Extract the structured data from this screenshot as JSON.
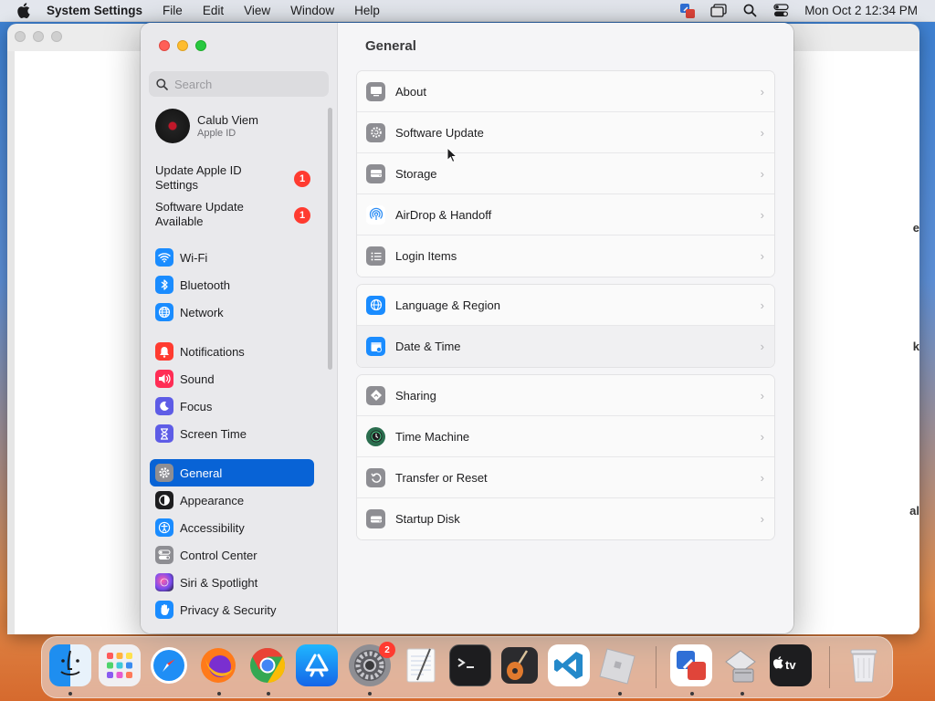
{
  "menubar": {
    "app_name": "System Settings",
    "menus": [
      "File",
      "Edit",
      "View",
      "Window",
      "Help"
    ],
    "clock": "Mon Oct 2  12:34 PM"
  },
  "background_window": {
    "peek_letters": [
      "e",
      "k",
      "al"
    ]
  },
  "sidebar": {
    "search_placeholder": "Search",
    "profile": {
      "name": "Calub Viem",
      "subtitle": "Apple ID"
    },
    "notices": [
      {
        "label": "Update Apple ID Settings",
        "badge": "1"
      },
      {
        "label": "Software Update Available",
        "badge": "1"
      }
    ],
    "groups": [
      [
        {
          "label": "Wi-Fi",
          "icon": "wifi-icon",
          "color": "#1a8cff"
        },
        {
          "label": "Bluetooth",
          "icon": "bluetooth-icon",
          "color": "#1a8cff"
        },
        {
          "label": "Network",
          "icon": "globe-icon",
          "color": "#1a8cff"
        }
      ],
      [
        {
          "label": "Notifications",
          "icon": "bell-icon",
          "color": "#ff3b30"
        },
        {
          "label": "Sound",
          "icon": "speaker-icon",
          "color": "#ff2d55"
        },
        {
          "label": "Focus",
          "icon": "moon-icon",
          "color": "#5e5ce6"
        },
        {
          "label": "Screen Time",
          "icon": "hourglass-icon",
          "color": "#5e5ce6"
        }
      ],
      [
        {
          "label": "General",
          "icon": "gear-icon",
          "color": "#8e8e93",
          "selected": true
        },
        {
          "label": "Appearance",
          "icon": "appearance-icon",
          "color": "#1d1d1f"
        },
        {
          "label": "Accessibility",
          "icon": "accessibility-icon",
          "color": "#1a8cff"
        },
        {
          "label": "Control Center",
          "icon": "toggles-icon",
          "color": "#8e8e93"
        },
        {
          "label": "Siri & Spotlight",
          "icon": "siri-icon",
          "color": "#a34fd6"
        },
        {
          "label": "Privacy & Security",
          "icon": "hand-icon",
          "color": "#1a8cff"
        }
      ]
    ]
  },
  "main": {
    "title": "General",
    "groups": [
      [
        {
          "label": "About",
          "icon": "display-icon",
          "color": "#8e8e93"
        },
        {
          "label": "Software Update",
          "icon": "update-gear-icon",
          "color": "#8e8e93"
        },
        {
          "label": "Storage",
          "icon": "drive-icon",
          "color": "#8e8e93"
        },
        {
          "label": "AirDrop & Handoff",
          "icon": "airdrop-icon",
          "color": "#ffffff"
        },
        {
          "label": "Login Items",
          "icon": "list-icon",
          "color": "#8e8e93"
        }
      ],
      [
        {
          "label": "Language & Region",
          "icon": "globe-icon",
          "color": "#1a8cff"
        },
        {
          "label": "Date & Time",
          "icon": "calendar-clock-icon",
          "color": "#1a8cff",
          "hover": true
        }
      ],
      [
        {
          "label": "Sharing",
          "icon": "sharing-icon",
          "color": "#8e8e93"
        },
        {
          "label": "Time Machine",
          "icon": "time-machine-icon",
          "color": "#2b6e4f"
        },
        {
          "label": "Transfer or Reset",
          "icon": "reset-icon",
          "color": "#8e8e93"
        },
        {
          "label": "Startup Disk",
          "icon": "disk-icon",
          "color": "#8e8e93"
        }
      ]
    ]
  },
  "dock": {
    "items": [
      {
        "name": "finder",
        "icon": "finder-icon",
        "running": true
      },
      {
        "name": "launchpad",
        "icon": "launchpad-icon",
        "running": false
      },
      {
        "name": "safari",
        "icon": "safari-icon",
        "running": false
      },
      {
        "name": "firefox",
        "icon": "firefox-icon",
        "running": true
      },
      {
        "name": "chrome",
        "icon": "chrome-icon",
        "running": true
      },
      {
        "name": "app-store",
        "icon": "app-store-icon",
        "running": false
      },
      {
        "name": "system-settings",
        "icon": "settings-gear-icon",
        "running": true,
        "badge": "2"
      },
      {
        "name": "textedit",
        "icon": "notepad-icon",
        "running": false
      },
      {
        "name": "terminal",
        "icon": "terminal-icon",
        "running": false
      },
      {
        "name": "garageband",
        "icon": "guitar-icon",
        "running": false
      },
      {
        "name": "vscode",
        "icon": "vscode-icon",
        "running": false
      },
      {
        "name": "roblox",
        "icon": "roblox-icon",
        "running": true
      },
      {
        "name": "remote-desktop",
        "icon": "remote-desktop-icon",
        "running": true
      },
      {
        "name": "vmware",
        "icon": "vm-icon",
        "running": true
      },
      {
        "name": "apple-tv",
        "icon": "apple-tv-icon",
        "running": false
      },
      {
        "name": "trash",
        "icon": "trash-icon",
        "running": false
      }
    ]
  }
}
